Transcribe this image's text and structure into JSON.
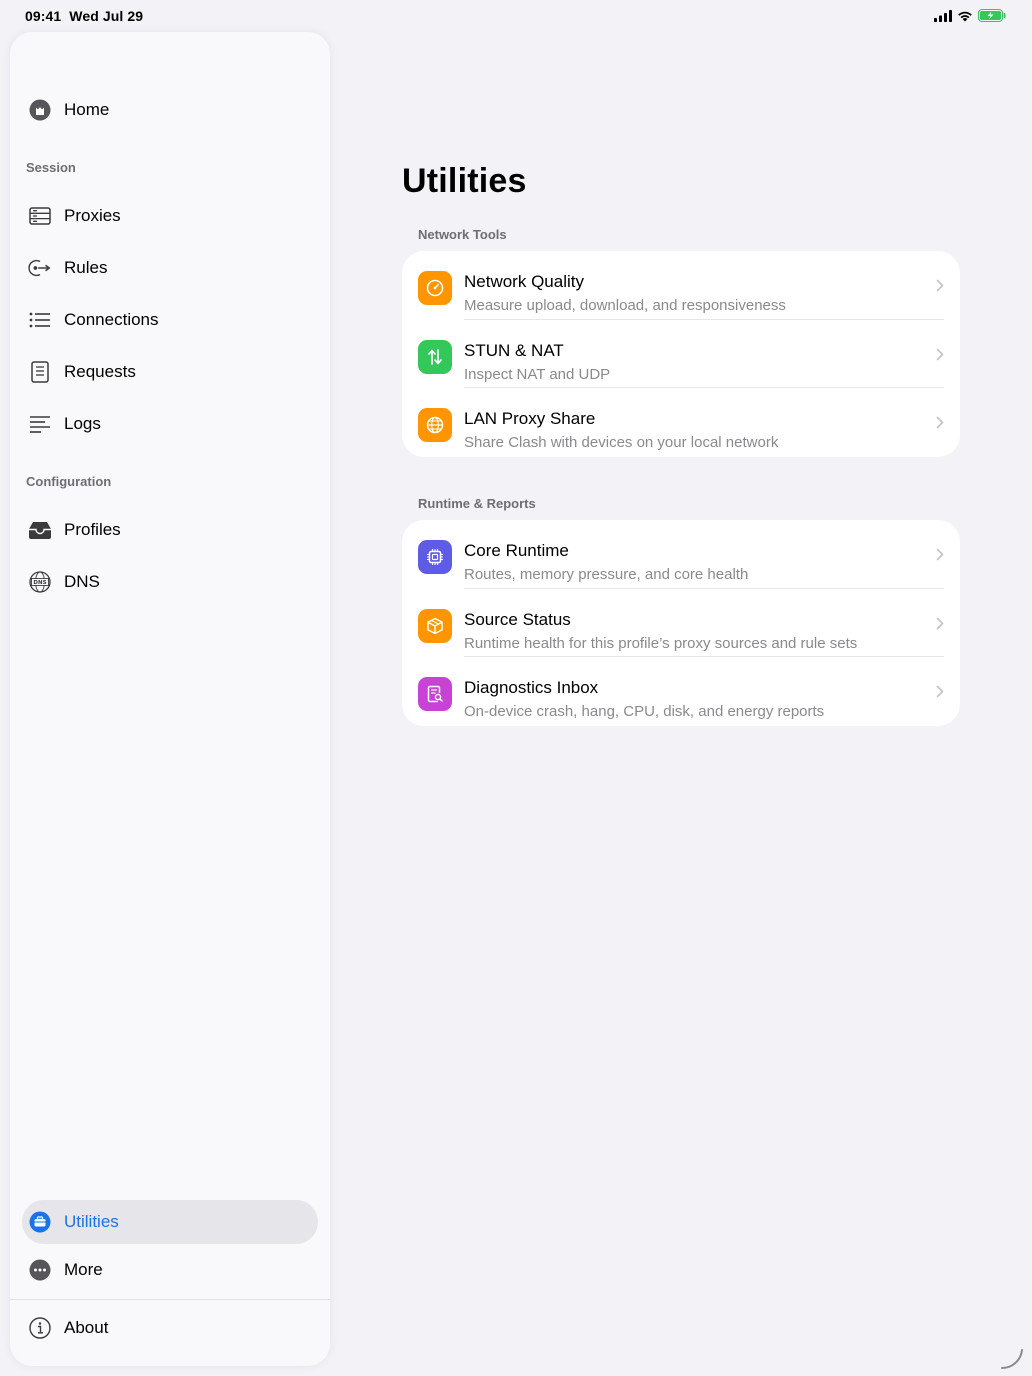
{
  "status_bar": {
    "time": "09:41",
    "date": "Wed Jul 29",
    "icons": [
      "cellular-signal-icon",
      "wifi-icon",
      "battery-charging-icon"
    ]
  },
  "sidebar": {
    "home": {
      "label": "Home",
      "icon": "home-icon"
    },
    "sections": [
      {
        "title": "Session"
      },
      {
        "title": "Configuration"
      }
    ],
    "session_items": [
      {
        "label": "Proxies",
        "icon": "server-icon"
      },
      {
        "label": "Rules",
        "icon": "route-arrow-icon"
      },
      {
        "label": "Connections",
        "icon": "list-bullet-icon"
      },
      {
        "label": "Requests",
        "icon": "document-icon"
      },
      {
        "label": "Logs",
        "icon": "text-lines-icon"
      }
    ],
    "config_items": [
      {
        "label": "Profiles",
        "icon": "tray-icon"
      },
      {
        "label": "DNS",
        "icon": "dns-globe-icon"
      }
    ],
    "bottom_items": [
      {
        "label": "Utilities",
        "icon": "toolbox-icon",
        "active": true
      },
      {
        "label": "More",
        "icon": "ellipsis-circle-icon",
        "active": false
      }
    ],
    "about": {
      "label": "About",
      "icon": "info-circle-icon"
    }
  },
  "main": {
    "title": "Utilities",
    "groups": [
      {
        "header": "Network Tools",
        "items": [
          {
            "title": "Network Quality",
            "subtitle": "Measure upload, download, and responsiveness",
            "icon": "speedometer-icon",
            "color": "#ff9500"
          },
          {
            "title": "STUN & NAT",
            "subtitle": "Inspect NAT and UDP",
            "icon": "arrows-up-down-icon",
            "color": "#34c759"
          },
          {
            "title": "LAN Proxy Share",
            "subtitle": "Share Clash with devices on your local network",
            "icon": "globe-icon",
            "color": "#ff9500"
          }
        ]
      },
      {
        "header": "Runtime & Reports",
        "items": [
          {
            "title": "Core Runtime",
            "subtitle": "Routes, memory pressure, and core health",
            "icon": "cpu-icon",
            "color": "#5e5ce6"
          },
          {
            "title": "Source Status",
            "subtitle": "Runtime health for this profile’s proxy sources and rule sets",
            "icon": "cube-icon",
            "color": "#ff9500"
          },
          {
            "title": "Diagnostics Inbox",
            "subtitle": "On-device crash, hang, CPU, disk, and energy reports",
            "icon": "doc-magnifier-icon",
            "color": "#c643d6"
          }
        ]
      }
    ]
  },
  "colors": {
    "accent": "#1a73e8",
    "background": "#f2f2f7"
  }
}
